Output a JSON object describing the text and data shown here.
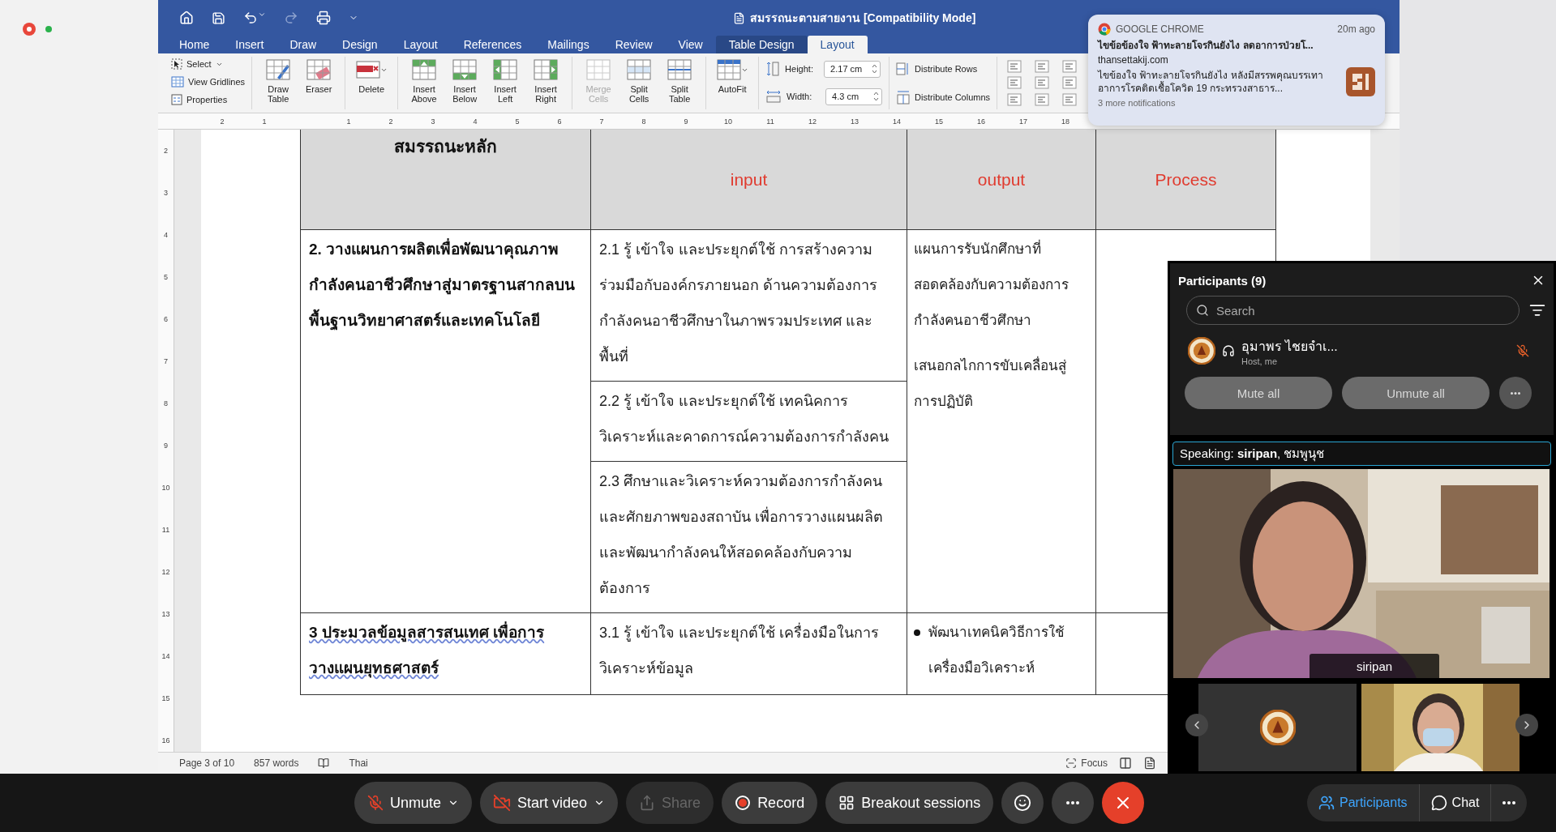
{
  "word": {
    "title": "สมรรถนะตามสายงาน [Compatibility Mode]",
    "tabs": [
      {
        "label": "Home",
        "selected": false,
        "contextual": false
      },
      {
        "label": "Insert",
        "selected": false,
        "contextual": false
      },
      {
        "label": "Draw",
        "selected": false,
        "contextual": false
      },
      {
        "label": "Design",
        "selected": false,
        "contextual": false
      },
      {
        "label": "Layout",
        "selected": false,
        "contextual": false
      },
      {
        "label": "References",
        "selected": false,
        "contextual": false
      },
      {
        "label": "Mailings",
        "selected": false,
        "contextual": false
      },
      {
        "label": "Review",
        "selected": false,
        "contextual": false
      },
      {
        "label": "View",
        "selected": false,
        "contextual": false
      },
      {
        "label": "Table Design",
        "selected": false,
        "contextual": true
      },
      {
        "label": "Layout",
        "selected": true,
        "contextual": true
      }
    ],
    "ribbon": {
      "small_items": [
        {
          "label": "Select",
          "kind": "select",
          "menu": true
        },
        {
          "label": "View Gridlines",
          "kind": "gridlines",
          "menu": false
        },
        {
          "label": "Properties",
          "kind": "properties",
          "menu": false
        }
      ],
      "groups": [
        [
          {
            "label": "Draw Table",
            "kind": "draw-table",
            "disabled": false,
            "menu": false
          },
          {
            "label": "Eraser",
            "kind": "eraser",
            "disabled": false,
            "menu": false
          }
        ],
        [
          {
            "label": "Delete",
            "kind": "delete",
            "disabled": false,
            "menu": true
          }
        ],
        [
          {
            "label": "Insert Above",
            "kind": "insert-above",
            "disabled": false,
            "menu": false
          },
          {
            "label": "Insert Below",
            "kind": "insert-below",
            "disabled": false,
            "menu": false
          },
          {
            "label": "Insert Left",
            "kind": "insert-left",
            "disabled": false,
            "menu": false
          },
          {
            "label": "Insert Right",
            "kind": "insert-right",
            "disabled": false,
            "menu": false
          }
        ],
        [
          {
            "label": "Merge Cells",
            "kind": "merge",
            "disabled": true,
            "menu": false
          },
          {
            "label": "Split Cells",
            "kind": "split-cells",
            "disabled": false,
            "menu": false
          },
          {
            "label": "Split Table",
            "kind": "split-table",
            "disabled": false,
            "menu": false
          }
        ],
        [
          {
            "label": "AutoFit",
            "kind": "autofit",
            "disabled": false,
            "menu": true
          }
        ]
      ],
      "size_fields": [
        {
          "label": "Height:",
          "value": "2.17 cm",
          "kind": "height"
        },
        {
          "label": "Width:",
          "value": "4.3 cm",
          "kind": "width"
        }
      ],
      "distribute": [
        {
          "label": "Distribute Rows",
          "kind": "rows"
        },
        {
          "label": "Distribute Columns",
          "kind": "columns"
        }
      ]
    },
    "ruler": {
      "horizontal": [
        "2",
        "1",
        "1",
        "2",
        "3",
        "4",
        "5",
        "6",
        "7",
        "8",
        "9",
        "10",
        "11",
        "12",
        "13",
        "14",
        "15",
        "16",
        "17",
        "18"
      ],
      "vertical": [
        "2",
        "3",
        "4",
        "5",
        "6",
        "7",
        "8",
        "9",
        "10",
        "11",
        "12",
        "13",
        "14",
        "15",
        "16"
      ]
    },
    "table": {
      "header": [
        {
          "text": "สมรรถนะหลัก",
          "color": "#111111"
        },
        {
          "text": "input",
          "color": "#e03b2f"
        },
        {
          "text": "output",
          "color": "#e03b2f"
        },
        {
          "text": "Process",
          "color": "#e03b2f"
        }
      ],
      "rows": [
        {
          "competency": "2. วางแผนการผลิตเพื่อพัฒนาคุณภาพกำลังคนอาชีวศึกษาสู่มาตรฐานสากลบนพื้นฐานวิทยาศาสตร์และเทคโนโลยี",
          "underlined": false,
          "inputs": [
            "2.1 รู้ เข้าใจ และประยุกต์ใช้ การสร้างความร่วมมือกับองค์กรภายนอก ด้านความต้องการกำลังคนอาชีวศึกษาในภาพรวมประเทศ และพื้นที่",
            "2.2 รู้ เข้าใจ และประยุกต์ใช้ เทคนิคการวิเคราะห์และคาดการณ์ความต้องการกำลังคน",
            "2.3 ศึกษาและวิเคราะห์ความต้องการกำลังคนและศักยภาพของสถาบัน เพื่อการวางแผนผลิตและพัฒนากำลังคนให้สอดคล้องกับความต้องการ"
          ],
          "outputs": [
            {
              "text": "แผนการรับนักศึกษาที่สอดคล้องกับความต้องการกำลังคนอาชีวศึกษา",
              "bullet": false
            },
            {
              "text": "เสนอกลไกการขับเคลื่อนสู่การปฏิบัติ",
              "bullet": false
            }
          ]
        },
        {
          "competency": "3 ประมวลข้อมูลสารสนเทศ  เพื่อการวางแผนยุทธศาสตร์",
          "underlined": true,
          "inputs": [
            "3.1 รู้ เข้าใจ และประยุกต์ใช้ เครื่องมือในการวิเคราะห์ข้อมูล"
          ],
          "outputs": [
            {
              "text": "พัฒนาเทคนิควิธีการใช้เครื่องมือวิเคราะห์",
              "bullet": true
            }
          ]
        }
      ]
    },
    "status": {
      "page": "Page 3 of 10",
      "words": "857 words",
      "language": "Thai",
      "focus": "Focus"
    }
  },
  "notification": {
    "app": "GOOGLE CHROME",
    "time": "20m ago",
    "title": "ไขข้อข้องใจ ฟ้าทะลายโจรกินยังไง ลดอาการป่วยโ...",
    "source": "thansettakij.com",
    "body": "ไขข้องใจ ฟ้าทะลายโจรกินยังไง หลังมีสรรพคุณบรรเทาอาการโรคติดเชื้อโควิด 19  กระทรวงสาธาร...",
    "more": "3 more notifications"
  },
  "participants": {
    "title": "Participants (9)",
    "search": {
      "placeholder": "Search"
    },
    "list": [
      {
        "name": "อุมาพร ไชยจำเ...",
        "role": "Host, me",
        "muted": true
      }
    ],
    "actions": [
      "Mute all",
      "Unmute all"
    ],
    "speaking": "Speaking: **siripan**, ชมพูนุช",
    "video_label": "siripan"
  },
  "meeting_toolbar": {
    "controls": [
      {
        "kind": "mic-off",
        "label": "Unmute",
        "menu": true,
        "disabled": false
      },
      {
        "kind": "video-off",
        "label": "Start video",
        "menu": true,
        "disabled": false
      },
      {
        "kind": "share",
        "label": "Share",
        "menu": false,
        "disabled": true
      },
      {
        "kind": "record",
        "label": "Record",
        "menu": false,
        "disabled": false
      },
      {
        "kind": "breakout",
        "label": "Breakout sessions",
        "menu": false,
        "disabled": false
      },
      {
        "kind": "reactions",
        "menu": false,
        "disabled": false
      },
      {
        "kind": "more",
        "menu": false,
        "disabled": false
      },
      {
        "kind": "end",
        "menu": false,
        "disabled": false
      }
    ],
    "panels": [
      {
        "kind": "participants",
        "label": "Participants",
        "selected": true
      },
      {
        "kind": "chat",
        "label": "Chat",
        "selected": false
      },
      {
        "kind": "more",
        "selected": false
      }
    ]
  }
}
